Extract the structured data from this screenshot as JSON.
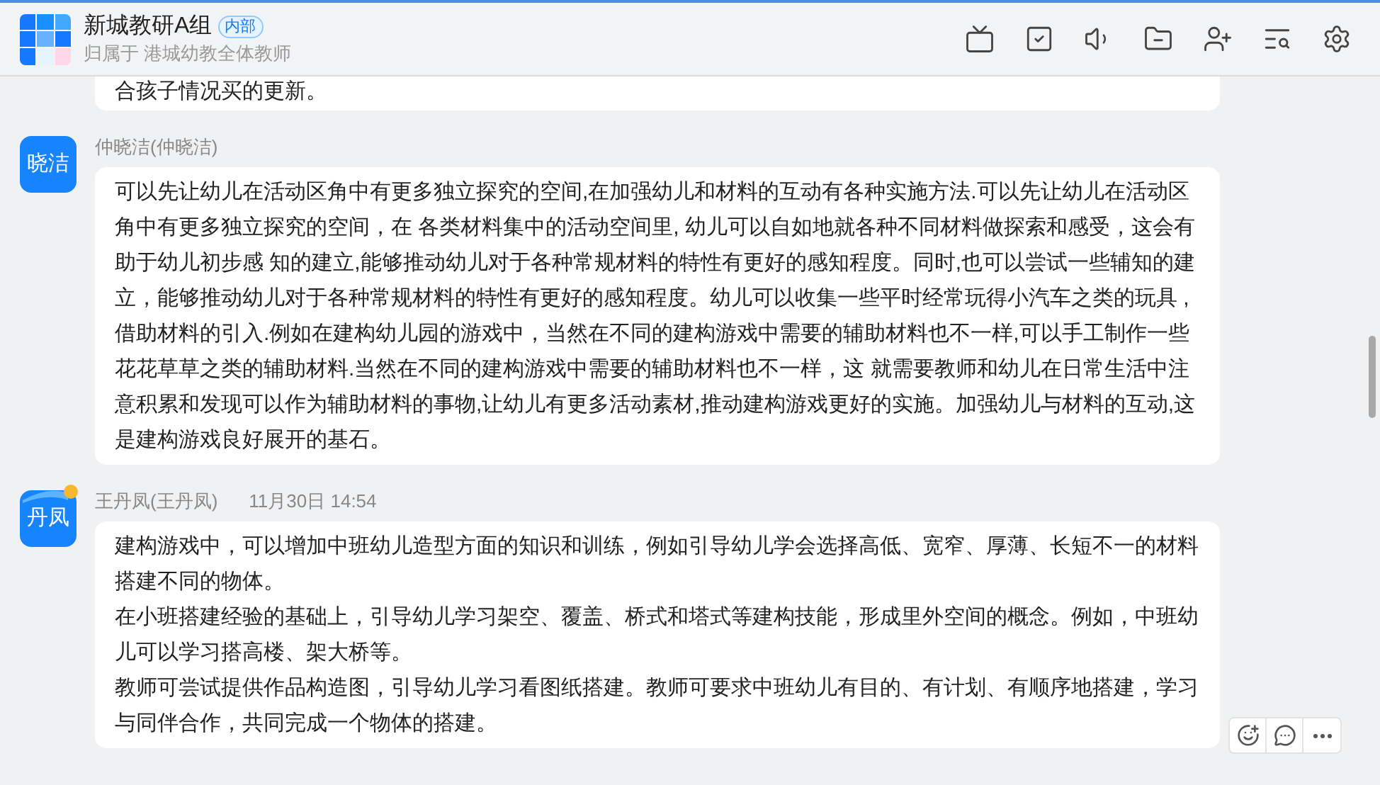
{
  "header": {
    "title": "新城教研A组",
    "badge": "内部",
    "subtitle": "归属于 港城幼教全体教师"
  },
  "messages": [
    {
      "kind": "partial",
      "paragraphs": [
        "合孩子情况买的更新。"
      ]
    },
    {
      "kind": "full",
      "avatar": "晓洁",
      "sender": "仲晓洁(仲晓洁)",
      "paragraphs": [
        "可以先让幼儿在活动区角中有更多独立探究的空间,在加强幼儿和材料的互动有各种实施方法.可以先让幼儿在活动区角中有更多独立探究的空间，在 各类材料集中的活动空间里, 幼儿可以自如地就各种不同材料做探索和感受，这会有助于幼儿初步感 知的建立,能够推动幼儿对于各种常规材料的特性有更好的感知程度。同时,也可以尝试一些辅知的建立，能够推动幼儿对于各种常规材料的特性有更好的感知程度。幼儿可以收集一些平时经常玩得小汽车之类的玩具 ,借助材料的引入.例如在建构幼儿园的游戏中，当然在不同的建构游戏中需要的辅助材料也不一样,可以手工制作一些花花草草之类的辅助材料.当然在不同的建构游戏中需要的辅助材料也不一样，这 就需要教师和幼儿在日常生活中注意积累和发现可以作为辅助材料的事物,让幼儿有更多活动素材,推动建构游戏更好的实施。加强幼儿与材料的互动,这是建构游戏良好展开的基石。"
      ]
    },
    {
      "kind": "full",
      "avatar": "丹凤",
      "ribbon": true,
      "sender": "王丹凤(王丹凤)",
      "time": "11月30日 14:54",
      "hovered": true,
      "paragraphs": [
        "建构游戏中，可以增加中班幼儿造型方面的知识和训练，例如引导幼儿学会选择高低、宽窄、厚薄、长短不一的材料搭建不同的物体。",
        "在小班搭建经验的基础上，引导幼儿学习架空、覆盖、桥式和塔式等建构技能，形成里外空间的概念。例如，中班幼儿可以学习搭高楼、架大桥等。",
        "教师可尝试提供作品构造图，引导幼儿学习看图纸搭建。教师可要求中班幼儿有目的、有计划、有顺序地搭建，学习与同伴合作，共同完成一个物体的搭建。"
      ]
    }
  ]
}
